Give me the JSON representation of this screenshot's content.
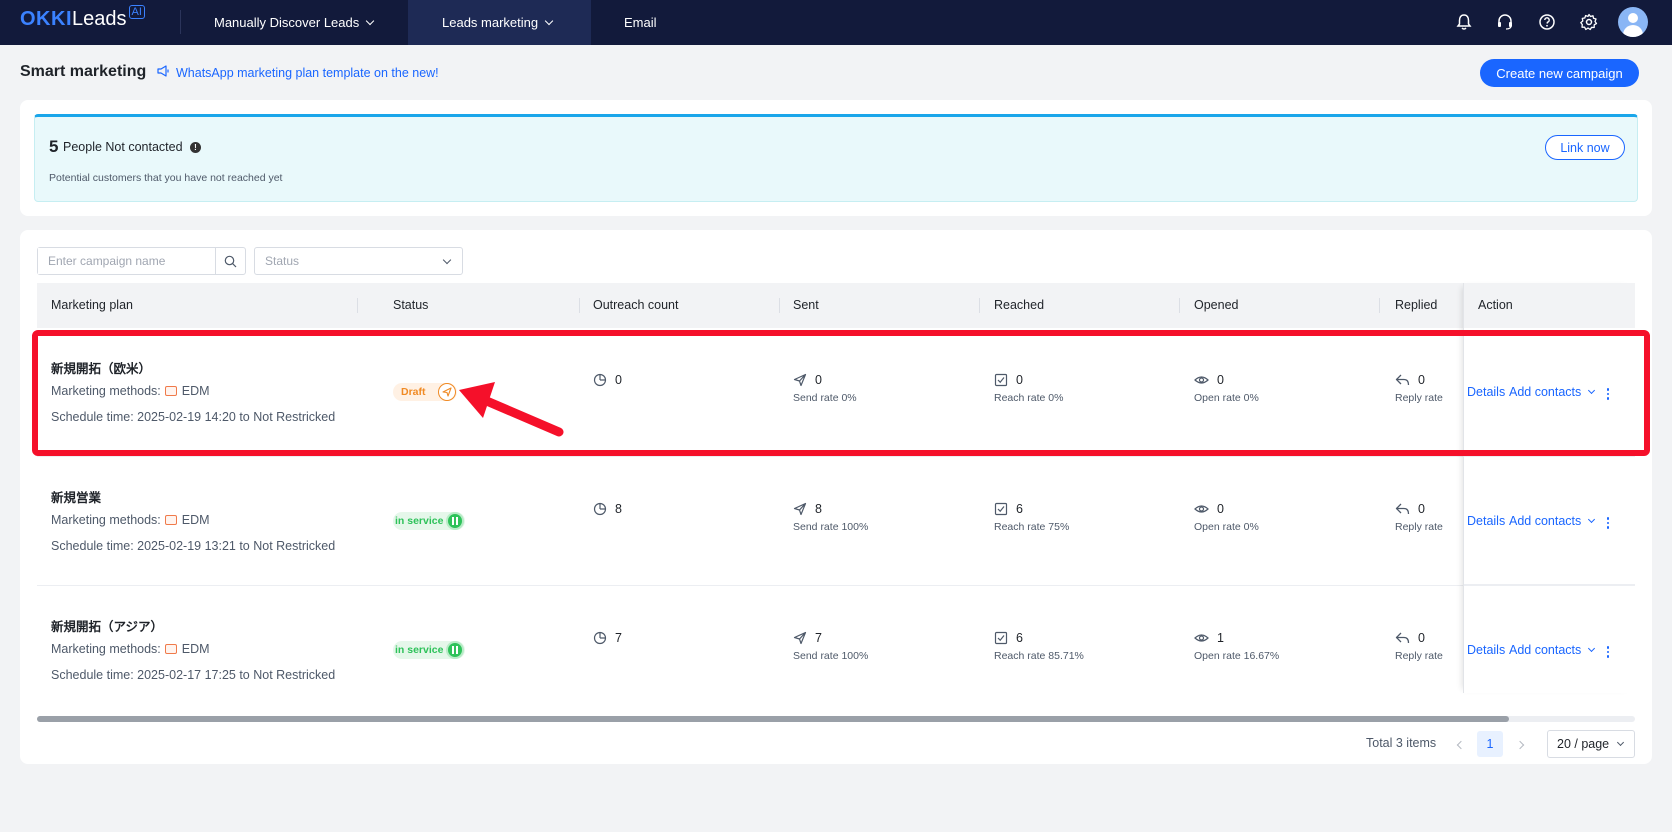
{
  "app": {
    "logo_main": "OKKI",
    "logo_sub": "Leads",
    "logo_badge": "AI"
  },
  "nav": {
    "items": [
      {
        "label": "Manually Discover Leads"
      },
      {
        "label": "Leads marketing"
      },
      {
        "label": "Email"
      }
    ],
    "icons": [
      "bell-icon",
      "headset-icon",
      "help-icon",
      "gear-icon"
    ]
  },
  "header": {
    "title": "Smart marketing",
    "promo_text": "WhatsApp marketing plan template on the new!",
    "create_button": "Create new campaign"
  },
  "banner": {
    "count": "5",
    "label": "People Not contacted",
    "info_glyph": "!",
    "subtitle": "Potential customers that you have not reached yet",
    "link_button": "Link now"
  },
  "filters": {
    "search_placeholder": "Enter campaign name",
    "status_placeholder": "Status"
  },
  "table": {
    "columns": {
      "plan": "Marketing plan",
      "status": "Status",
      "outreach": "Outreach count",
      "sent": "Sent",
      "reached": "Reached",
      "opened": "Opened",
      "replied": "Replied",
      "action": "Action"
    },
    "rows": [
      {
        "name": "新規開拓（欧米）",
        "method_label": "Marketing methods:",
        "method": "EDM",
        "schedule": "Schedule time: 2025-02-19 14:20 to Not Restricked",
        "status": "Draft",
        "outreach": "0",
        "sent": "0",
        "sent_rate": "Send rate 0%",
        "reached": "0",
        "reached_rate": "Reach rate 0%",
        "opened": "0",
        "opened_rate": "Open rate 0%",
        "replied": "0",
        "replied_rate": "Reply rate",
        "details": "Details",
        "add_contacts": "Add contacts"
      },
      {
        "name": "新規営業",
        "method_label": "Marketing methods:",
        "method": "EDM",
        "schedule": "Schedule time: 2025-02-19 13:21 to Not Restricked",
        "status": "in service",
        "outreach": "8",
        "sent": "8",
        "sent_rate": "Send rate 100%",
        "reached": "6",
        "reached_rate": "Reach rate 75%",
        "opened": "0",
        "opened_rate": "Open rate 0%",
        "replied": "0",
        "replied_rate": "Reply rate",
        "details": "Details",
        "add_contacts": "Add contacts"
      },
      {
        "name": "新規開拓（アジア）",
        "method_label": "Marketing methods:",
        "method": "EDM",
        "schedule": "Schedule time: 2025-02-17 17:25 to Not Restricked",
        "status": "in service",
        "outreach": "7",
        "sent": "7",
        "sent_rate": "Send rate 100%",
        "reached": "6",
        "reached_rate": "Reach rate 85.71%",
        "opened": "1",
        "opened_rate": "Open rate 16.67%",
        "replied": "0",
        "replied_rate": "Reply rate",
        "details": "Details",
        "add_contacts": "Add contacts"
      }
    ]
  },
  "pagination": {
    "total": "Total 3 items",
    "current_page": "1",
    "page_size": "20 / page"
  },
  "colors": {
    "topbar": "#121a3b",
    "accent": "#1a66ff",
    "draft": "#f08a24",
    "in_service": "#2ec25a",
    "annotation": "#f5102a"
  }
}
